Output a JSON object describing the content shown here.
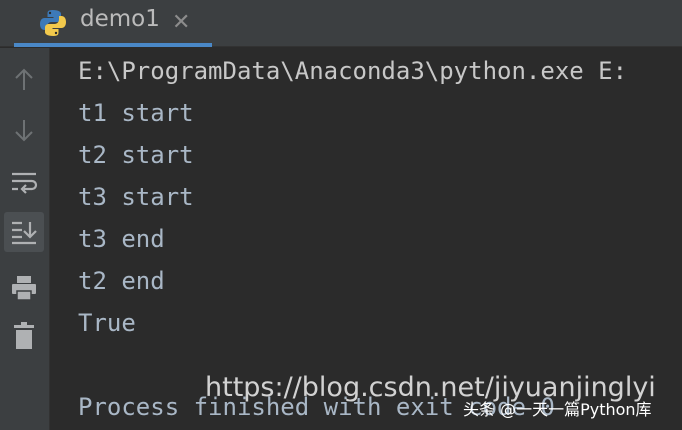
{
  "tab": {
    "title": "demo1",
    "close": "✕"
  },
  "toolbar": {
    "items": [
      "up-arrow",
      "down-arrow",
      "soft-wrap",
      "scroll-to-end",
      "print",
      "trash"
    ]
  },
  "console": {
    "lines": [
      "E:\\ProgramData\\Anaconda3\\python.exe E:",
      "t1 start",
      "t2 start",
      "t3 start",
      "t3 end",
      "t2 end",
      "True",
      "",
      "Process finished with exit code 0"
    ]
  },
  "watermark": {
    "url": "https://blog.csdn.net/jiyuanjinglyi",
    "credit": "头条 @一天一篇Python库"
  },
  "colors": {
    "accent": "#4a88c7",
    "background": "#2b2b2b",
    "panel": "#3c3f41"
  }
}
